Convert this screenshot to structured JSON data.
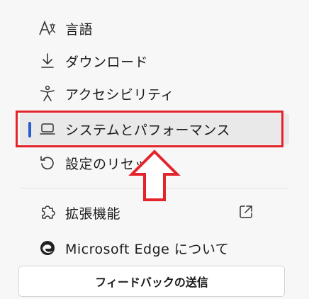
{
  "menu": {
    "items": [
      {
        "label": "言語",
        "icon": "language-icon"
      },
      {
        "label": "ダウンロード",
        "icon": "download-icon"
      },
      {
        "label": "アクセシビリティ",
        "icon": "accessibility-icon"
      },
      {
        "label": "システムとパフォーマンス",
        "icon": "laptop-icon",
        "selected": true
      },
      {
        "label": "設定のリセット",
        "icon": "reset-icon"
      },
      {
        "label": "拡張機能",
        "icon": "extensions-icon",
        "external": true
      },
      {
        "label": "Microsoft Edge について",
        "icon": "edge-logo-icon"
      }
    ]
  },
  "feedback": {
    "label": "フィードバックの送信"
  },
  "colors": {
    "selection_indicator": "#2a5ccf",
    "highlight_annotation": "#e3242b"
  }
}
